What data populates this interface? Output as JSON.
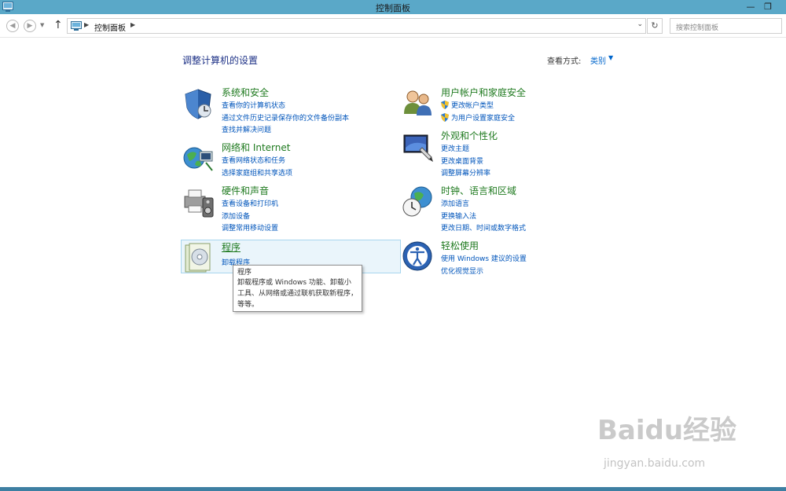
{
  "window": {
    "title": "控制面板"
  },
  "toolbar": {
    "breadcrumb": "控制面板",
    "search_placeholder": "搜索控制面板"
  },
  "main": {
    "heading": "调整计算机的设置",
    "view_by_label": "查看方式:",
    "view_by_value": "类别"
  },
  "categories": {
    "system": {
      "title": "系统和安全",
      "links": [
        "查看你的计算机状态",
        "通过文件历史记录保存你的文件备份副本",
        "查找并解决问题"
      ]
    },
    "network": {
      "title": "网络和 Internet",
      "links": [
        "查看网络状态和任务",
        "选择家庭组和共享选项"
      ]
    },
    "hardware": {
      "title": "硬件和声音",
      "links": [
        "查看设备和打印机",
        "添加设备",
        "调整常用移动设置"
      ]
    },
    "programs": {
      "title": "程序",
      "links": [
        "卸载程序"
      ]
    },
    "users": {
      "title": "用户帐户和家庭安全",
      "links": [
        "更改帐户类型",
        "为用户设置家庭安全"
      ]
    },
    "appearance": {
      "title": "外观和个性化",
      "links": [
        "更改主题",
        "更改桌面背景",
        "调整屏幕分辨率"
      ]
    },
    "clock": {
      "title": "时钟、语言和区域",
      "links": [
        "添加语言",
        "更换输入法",
        "更改日期、时间或数字格式"
      ]
    },
    "ease": {
      "title": "轻松使用",
      "links": [
        "使用 Windows 建议的设置",
        "优化视觉显示"
      ]
    }
  },
  "tooltip": {
    "title": "程序",
    "body": "卸载程序或 Windows 功能、卸载小工具、从网络或通过联机获取新程序，等等。"
  },
  "watermark": {
    "logo": "Baidu经验",
    "url": "jingyan.baidu.com"
  },
  "icons": {
    "app": "control-panel-icon",
    "back": "arrow-left-icon",
    "forward": "arrow-right-icon",
    "up": "arrow-up-icon",
    "refresh": "refresh-icon"
  },
  "colors": {
    "titlebar": "#5aa8c8",
    "link": "#0055bb",
    "category_title": "#1f7a1f",
    "heading": "#1e3287"
  }
}
